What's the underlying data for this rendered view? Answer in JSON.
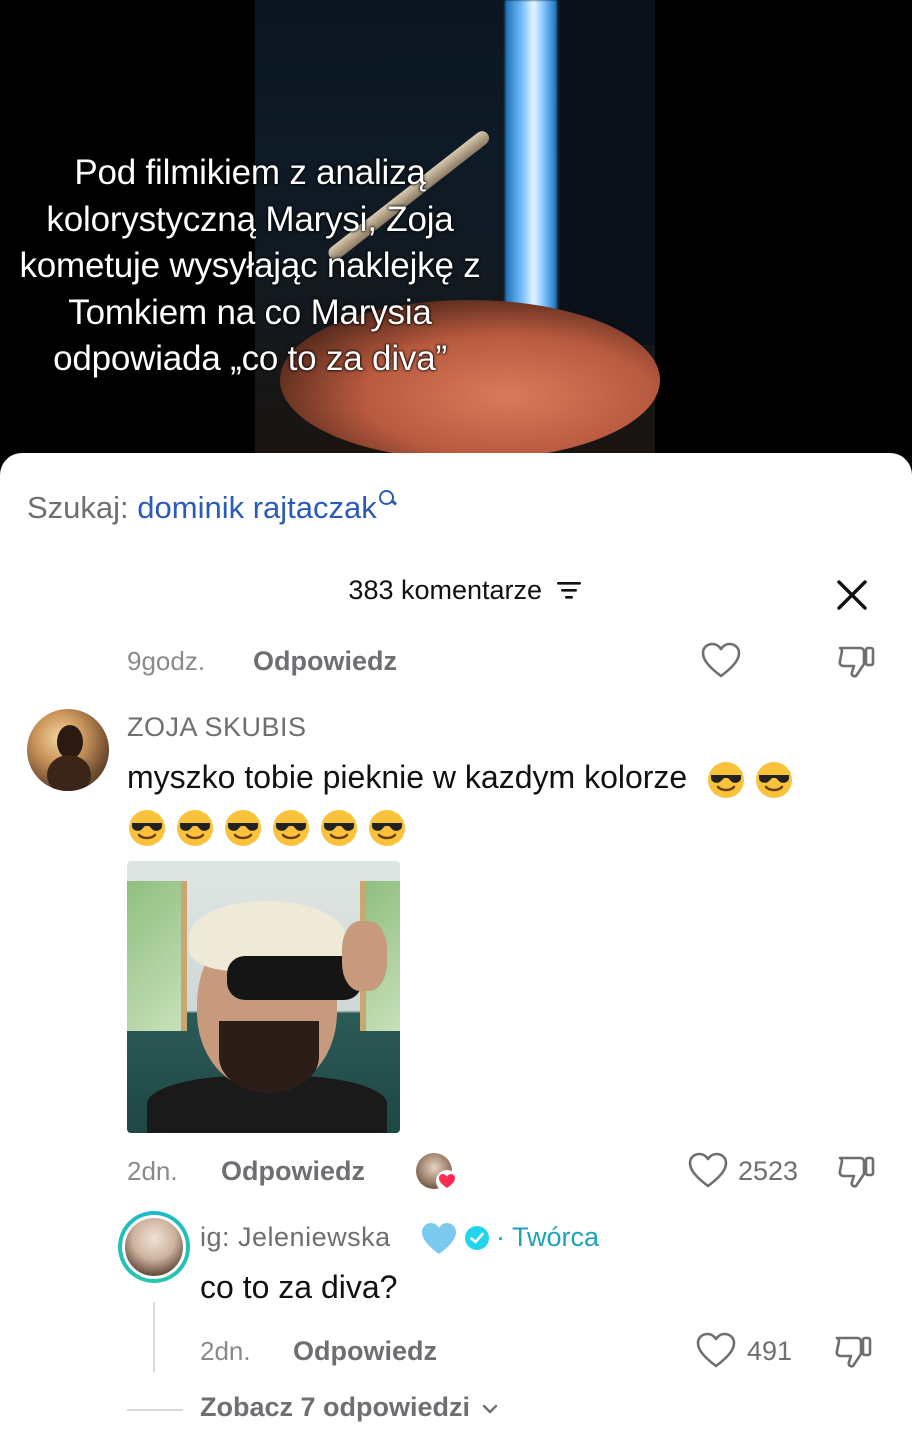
{
  "video": {
    "caption": "Pod filmikiem z analizą kolorystyczną Marysi, Zoja kometuje wysyłając naklejkę z Tomkiem na co Marysia odpowiada „co to za diva”"
  },
  "search": {
    "prefix": "Szukaj:",
    "term": "dominik rajtaczak",
    "icon": "search-icon"
  },
  "comments_header": {
    "count_label": "383 komentarze",
    "filter_icon": "filter-icon",
    "close_icon": "close-icon"
  },
  "previous_comment": {
    "time": "9godz.",
    "reply_label": "Odpowiedz",
    "like_icon": "heart-icon",
    "dislike_icon": "dislike-icon"
  },
  "comment": {
    "username": "ZOJA SKUBIS",
    "text": "myszko tobie pieknie w kazdym kolorze",
    "emoji": "smiling-face-with-sunglasses",
    "emoji_count": 8,
    "sticker": "sticker-image",
    "time": "2dn.",
    "reply_label": "Odpowiedz",
    "likes": "2523",
    "liked_by_creator": true
  },
  "reply": {
    "username": "ig: Jeleniewska",
    "badge_emoji": "light-blue-heart",
    "verified": true,
    "separator": "·",
    "creator_label": "Twórca",
    "text": "co to za diva?",
    "time": "2dn.",
    "reply_label": "Odpowiedz",
    "likes": "491"
  },
  "see_replies": {
    "label": "Zobacz 7 odpowiedzi"
  },
  "colors": {
    "accent_search": "#2b5bb6",
    "creator": "#1ea2b8",
    "heart_red": "#fe2c55",
    "gray_text": "#6e6e73"
  }
}
